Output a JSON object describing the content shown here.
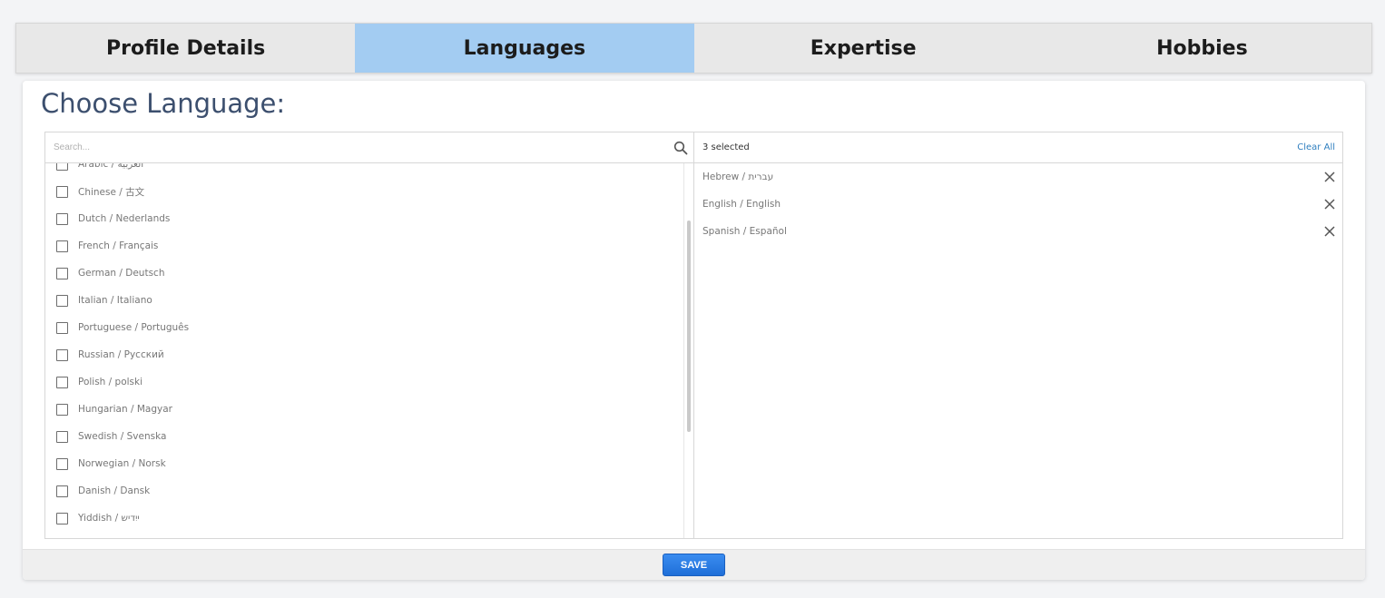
{
  "tabs": [
    {
      "label": "Profile Details",
      "active": false
    },
    {
      "label": "Languages",
      "active": true
    },
    {
      "label": "Expertise",
      "active": false
    },
    {
      "label": "Hobbies",
      "active": false
    }
  ],
  "page": {
    "title": "Choose Language:"
  },
  "search": {
    "placeholder": "Search...",
    "value": ""
  },
  "available_languages": [
    {
      "label": "Arabic / العربية",
      "checked": false
    },
    {
      "label": "Chinese / 古文",
      "checked": false
    },
    {
      "label": "Dutch / Nederlands",
      "checked": false
    },
    {
      "label": "French / Français",
      "checked": false
    },
    {
      "label": "German / Deutsch",
      "checked": false
    },
    {
      "label": "Italian / Italiano",
      "checked": false
    },
    {
      "label": "Portuguese / Português",
      "checked": false
    },
    {
      "label": "Russian / Русский",
      "checked": false
    },
    {
      "label": "Polish / polski",
      "checked": false
    },
    {
      "label": "Hungarian / Magyar",
      "checked": false
    },
    {
      "label": "Swedish / Svenska",
      "checked": false
    },
    {
      "label": "Norwegian / Norsk",
      "checked": false
    },
    {
      "label": "Danish / Dansk",
      "checked": false
    },
    {
      "label": "Yiddish / ייִדיש",
      "checked": false
    }
  ],
  "selected_panel": {
    "count_label": "3 selected",
    "clear_all_label": "Clear All",
    "items": [
      {
        "label": "Hebrew / עברית"
      },
      {
        "label": "English / English"
      },
      {
        "label": "Spanish / Español"
      }
    ]
  },
  "footer": {
    "save_label": "SAVE"
  },
  "colors": {
    "active_tab": "#a3ccf2",
    "title": "#3c4f6e",
    "link": "#2f7fbf",
    "save_button": "#2a7de6"
  },
  "icons": {
    "search": "search-icon",
    "remove": "close-icon"
  }
}
